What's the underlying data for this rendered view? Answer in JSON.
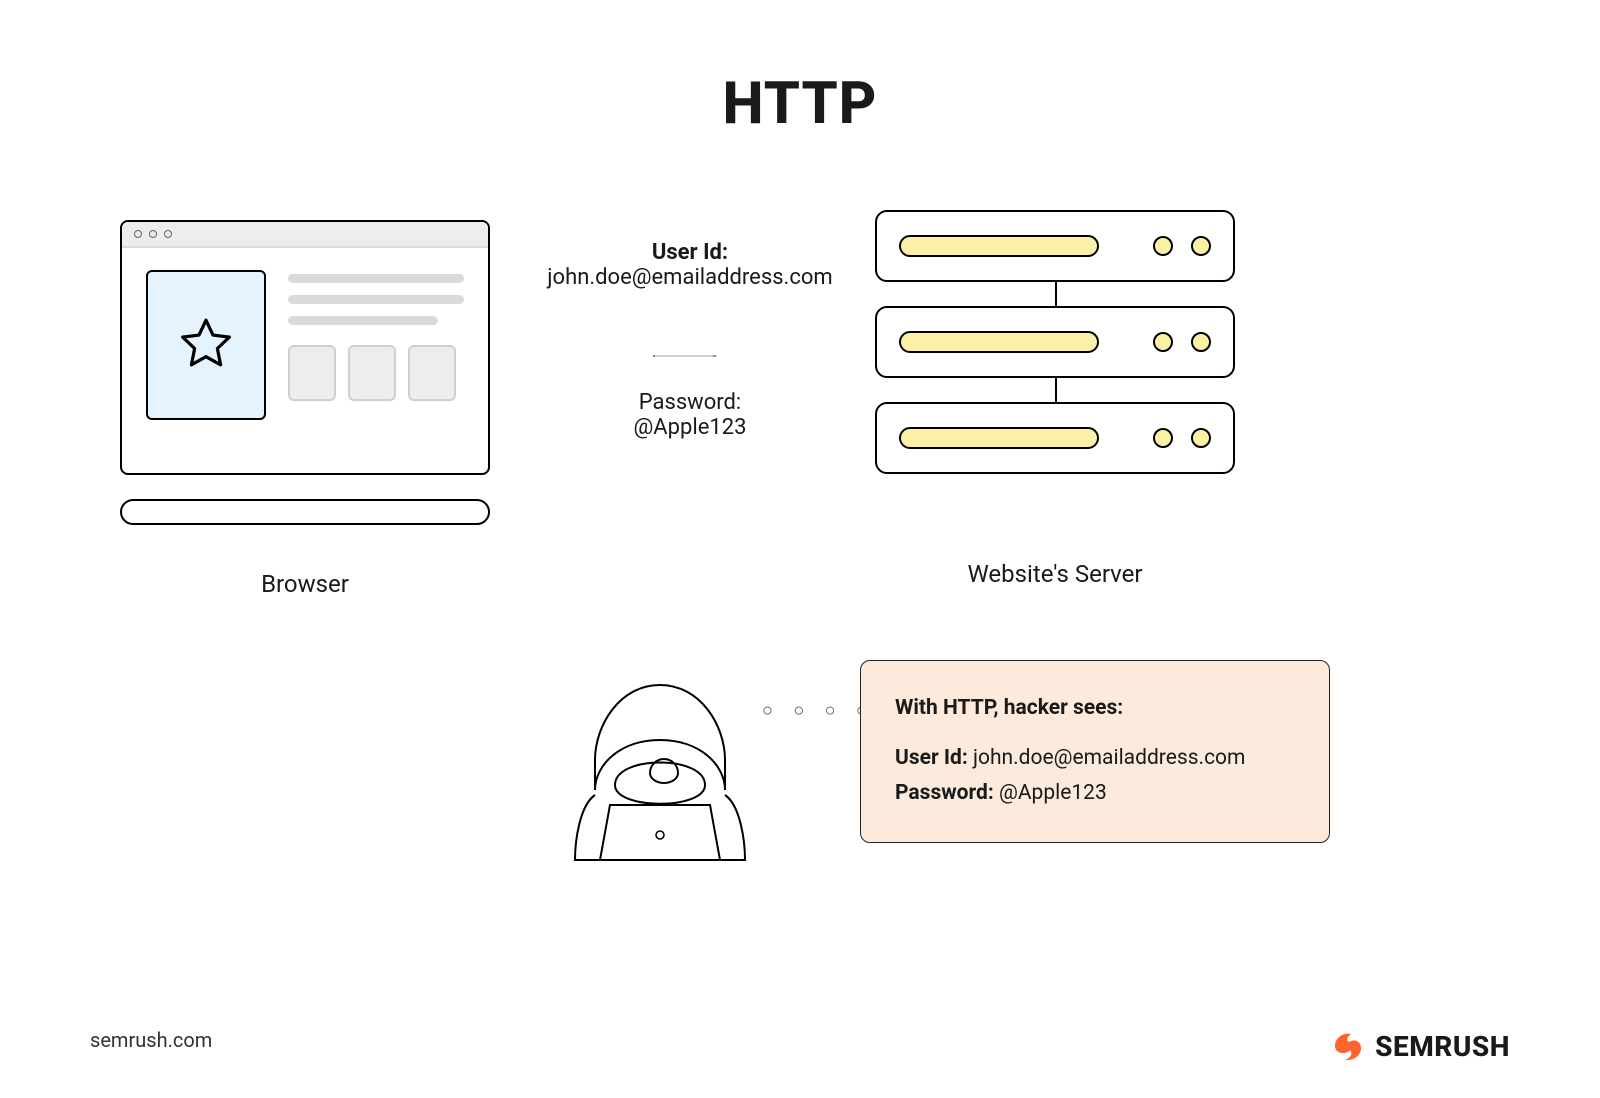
{
  "title": "HTTP",
  "browser_label": "Browser",
  "server_label": "Website's Server",
  "transfer": {
    "user_id_label": "User Id:",
    "user_id_value": "john.doe@emailaddress.com",
    "password_label": "Password:",
    "password_value": "@Apple123"
  },
  "hacker_box": {
    "heading": "With HTTP, hacker sees:",
    "user_id_label": "User Id:",
    "user_id_value": "john.doe@emailaddress.com",
    "password_label": "Password:",
    "password_value": "@Apple123"
  },
  "footer": {
    "url": "semrush.com",
    "brand": "SEMRUSH"
  },
  "colors": {
    "accent_orange": "#FF642D",
    "pale_yellow": "#FBF0A6",
    "pale_blue": "#E5F3FF",
    "pale_peach": "#FCEBDD"
  }
}
